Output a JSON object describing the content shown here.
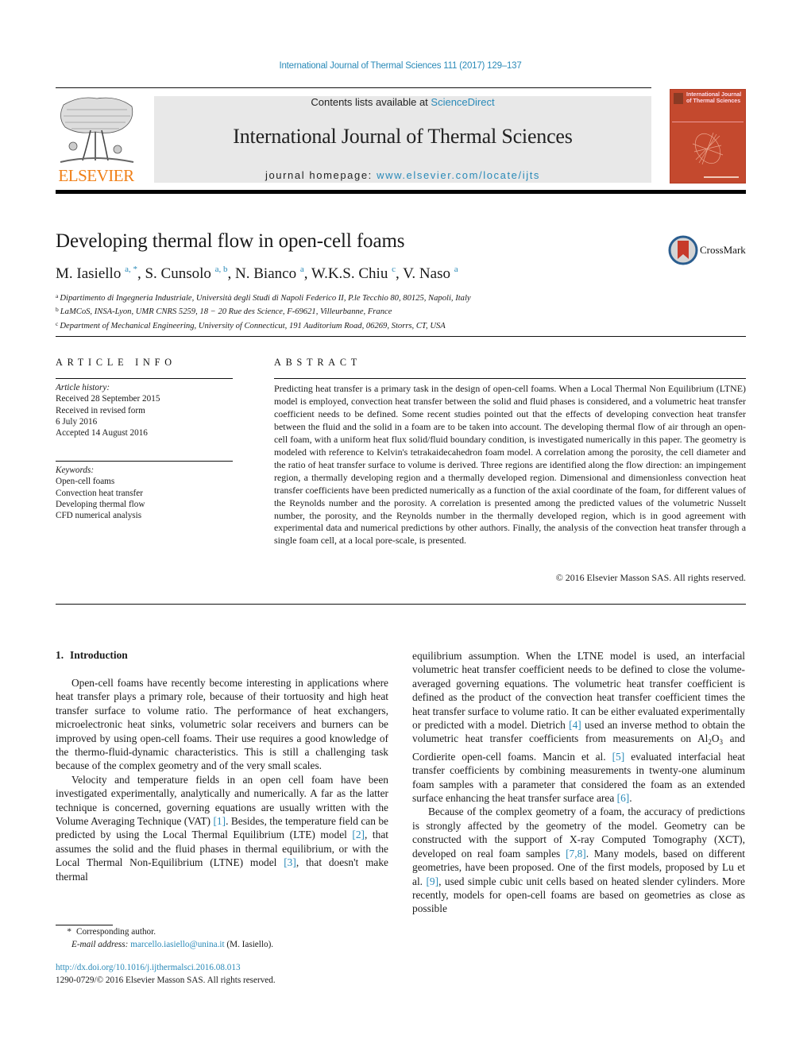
{
  "header": {
    "citation": "International Journal of Thermal Sciences 111 (2017) 129–137",
    "contents_prefix": "Contents lists available at ",
    "contents_link": "ScienceDirect",
    "journal_title": "International Journal of Thermal Sciences",
    "homepage_prefix": "journal homepage: ",
    "homepage_link": "www.elsevier.com/locate/ijts",
    "publisher": "ELSEVIER",
    "cover_title": "International Journal of Thermal Sciences",
    "colors": {
      "link": "#2a8ab8",
      "elsevier_orange": "#f07f16",
      "cover": "#c4492e",
      "banner_bg": "#e8e8e8"
    }
  },
  "article": {
    "title": "Developing thermal flow in open-cell foams",
    "crossmark_label": "CrossMark",
    "authors": [
      {
        "name": "M. Iasiello",
        "marks": "a, *"
      },
      {
        "name": "S. Cunsolo",
        "marks": "a, b"
      },
      {
        "name": "N. Bianco",
        "marks": "a"
      },
      {
        "name": "W.K.S. Chiu",
        "marks": "c"
      },
      {
        "name": "V. Naso",
        "marks": "a"
      }
    ],
    "affiliations": [
      {
        "mark": "a",
        "text": "Dipartimento di Ingegneria Industriale, Università degli Studi di Napoli Federico II, P.le Tecchio 80, 80125, Napoli, Italy"
      },
      {
        "mark": "b",
        "text": "LaMCoS, INSA-Lyon, UMR CNRS 5259, 18 − 20 Rue des Science, F-69621, Villeurbanne, France"
      },
      {
        "mark": "c",
        "text": "Department of Mechanical Engineering, University of Connecticut, 191 Auditorium Road, 06269, Storrs, CT, USA"
      }
    ]
  },
  "article_info": {
    "label": "ARTICLE INFO",
    "history_heading": "Article history:",
    "history": [
      "Received 28 September 2015",
      "Received in revised form",
      "6 July 2016",
      "Accepted 14 August 2016"
    ],
    "keywords_heading": "Keywords:",
    "keywords": [
      "Open-cell foams",
      "Convection heat transfer",
      "Developing thermal flow",
      "CFD numerical analysis"
    ]
  },
  "abstract": {
    "label": "ABSTRACT",
    "text": "Predicting heat transfer is a primary task in the design of open-cell foams. When a Local Thermal Non Equilibrium (LTNE) model is employed, convection heat transfer between the solid and fluid phases is considered, and a volumetric heat transfer coefficient needs to be defined. Some recent studies pointed out that the effects of developing convection heat transfer between the fluid and the solid in a foam are to be taken into account. The developing thermal flow of air through an open-cell foam, with a uniform heat flux solid/fluid boundary condition, is investigated numerically in this paper. The geometry is modeled with reference to Kelvin's tetrakaidecahedron foam model. A correlation among the porosity, the cell diameter and the ratio of heat transfer surface to volume is derived. Three regions are identified along the flow direction: an impingement region, a thermally developing region and a thermally developed region. Dimensional and dimensionless convection heat transfer coefficients have been pre­dicted numerically as a function of the axial coordinate of the foam, for different values of the Reynolds number and the porosity. A correlation is presented among the predicted values of the volumetric Nusselt number, the porosity, and the Reynolds number in the thermally developed region, which is in good agreement with experimental data and numerical predictions by other authors. Finally, the analysis of the convection heat transfer through a single foam cell, at a local pore-scale, is presented.",
    "copyright": "© 2016 Elsevier Masson SAS. All rights reserved."
  },
  "body": {
    "section_number": "1.",
    "section_title": "Introduction",
    "p1": "Open-cell foams have recently become interesting in applica­tions where heat transfer plays a primary role, because of their tortuosity and high heat transfer surface to volume ratio. The per­formance of heat exchangers, microelectronic heat sinks, volu­metric solar receivers and burners can be improved by using open-cell foams. Their use requires a good knowledge of the thermo-fluid-dynamic characteristics. This is still a challenging task because of the complex geometry and of the very small scales.",
    "p2": [
      "Velocity and temperature fields in an open cell foam have been investigated experimentally, analytically and numerically. A far as the latter technique is concerned, governing equations are usually written with the Volume Averaging Technique (VAT) ",
      "[1]",
      ". Besides, the temperature field can be predicted by using the Local Thermal Equilibrium (LTE) model ",
      "[2]",
      ", that assumes the solid and the fluid phases in thermal equilibrium, or with the Local Thermal Non-Equilibrium (LTNE) model ",
      "[3]",
      ", that doesn't make thermal"
    ],
    "p2_cont": [
      "equilibrium assumption. When the LTNE model is used, an inter­facial volumetric heat transfer coefficient needs to be defined to close the volume-averaged governing equations. The volumetric heat transfer coefficient is defined as the product of the convection heat transfer coefficient times the heat transfer surface to volume ratio. It can be either evaluated experimentally or predicted with a model. Dietrich ",
      "[4]",
      " used an inverse method to obtain the volu­metric heat transfer coefficients from measurements on Al",
      "2",
      "O",
      "3",
      " and Cordierite open-cell foams. Mancin et al. ",
      "[5]",
      " evaluated interfacial heat transfer coefficients by combining measurements in twenty-one aluminum foam samples with a parameter that considered the foam as an extended surface enhancing the heat transfer sur­face area ",
      "[6]",
      "."
    ],
    "p3": [
      "Because of the complex geometry of a foam, the accuracy of predictions is strongly affected by the geometry of the model. Ge­ometry can be constructed with the support of X-ray Computed Tomography (XCT), developed on real foam samples ",
      "[7,8]",
      ". Many models, based on different geometries, have been proposed. One of the first models, proposed by Lu et al. ",
      "[9]",
      ", used simple cubic unit cells based on heated slender cylinders. More recently, models for open-cell foams are based on geometries as close as possible"
    ]
  },
  "footnotes": {
    "star": "*",
    "corresponding": "Corresponding author.",
    "email_label": "E-mail address:",
    "email": "marcello.iasiello@unina.it",
    "email_suffix": " (M. Iasiello).",
    "doi": "http://dx.doi.org/10.1016/j.ijthermalsci.2016.08.013",
    "issn": "1290-0729/© 2016 Elsevier Masson SAS. All rights reserved."
  }
}
